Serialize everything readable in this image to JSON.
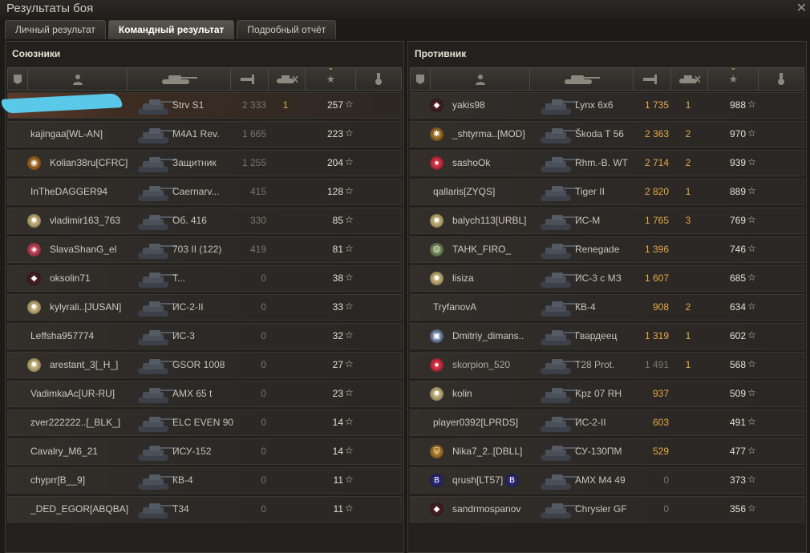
{
  "window": {
    "title": "Результаты боя",
    "close_glyph": "✕"
  },
  "tabs": [
    {
      "label": "Личный результат"
    },
    {
      "label": "Командный результат",
      "active": true
    },
    {
      "label": "Подробный отчёт"
    }
  ],
  "allies": {
    "title": "Союзники",
    "rows": [
      {
        "name": "",
        "vehicle": "Strv S1",
        "damage": "2 333",
        "kills": "1",
        "xp": "257",
        "self": true
      },
      {
        "name": "kajingaa[WL-AN]",
        "vehicle": "M4A1 Rev.",
        "damage": "1 665",
        "kills": "",
        "xp": "223"
      },
      {
        "name": "Kolian38ru[CFRC]",
        "badge": "clan",
        "vehicle": "Защитник",
        "damage": "1 255",
        "kills": "",
        "xp": "204"
      },
      {
        "name": "InTheDAGGER94",
        "vehicle": "Caernarv...",
        "damage": "415",
        "kills": "",
        "xp": "128"
      },
      {
        "name": "vladimir163_763",
        "badge": "star",
        "vehicle": "Об. 416",
        "damage": "330",
        "kills": "",
        "xp": "85"
      },
      {
        "name": "SlavaShanG_el",
        "badge": "shield",
        "vehicle": "703 II (122)",
        "damage": "419",
        "kills": "",
        "xp": "81"
      },
      {
        "name": "oksolin71",
        "badge": "diamond",
        "vehicle": "T...",
        "damage": "0",
        "kills": "",
        "xp": "38"
      },
      {
        "name": "kylyrali..[JUSAN]",
        "badge": "star",
        "vehicle": "ИС-2-II",
        "damage": "0",
        "kills": "",
        "xp": "33"
      },
      {
        "name": "Leffsha957774",
        "vehicle": "ИС-3",
        "damage": "0",
        "kills": "",
        "xp": "32"
      },
      {
        "name": "arestant_3[_H_]",
        "badge": "star",
        "vehicle": "GSOR 1008",
        "damage": "0",
        "kills": "",
        "xp": "27"
      },
      {
        "name": "VadimkaAc[UR-RU]",
        "vehicle": "AMX 65 t",
        "damage": "0",
        "kills": "",
        "xp": "23"
      },
      {
        "name": "zver222222..[_BLK_]",
        "vehicle": "ELC EVEN 90",
        "damage": "0",
        "kills": "",
        "xp": "14"
      },
      {
        "name": "Cavalry_M6_21",
        "vehicle": "ИСУ-152",
        "damage": "0",
        "kills": "",
        "xp": "14"
      },
      {
        "name": "chyprr[B__9]",
        "vehicle": "КВ-4",
        "damage": "0",
        "kills": "",
        "xp": "11"
      },
      {
        "name": "_DED_EGOR[ABQBA]",
        "vehicle": "T34",
        "damage": "0",
        "kills": "",
        "xp": "11"
      }
    ]
  },
  "enemies": {
    "title": "Противник",
    "rows": [
      {
        "name": "yakis98",
        "badge": "diamond",
        "vehicle": "Lynx 6x6",
        "damage": "1 735",
        "kills": "1",
        "xp": "988"
      },
      {
        "name": "_shtyrma..[MOD]",
        "badge": "square",
        "vehicle": "Škoda T 56",
        "damage": "2 363",
        "kills": "2",
        "xp": "970"
      },
      {
        "name": "sashoOk",
        "badge": "red",
        "vehicle": "Rhm.-B. WT",
        "damage": "2 714",
        "kills": "2",
        "xp": "939"
      },
      {
        "name": "qallaris[ZYQS]",
        "vehicle": "Tiger II",
        "damage": "2 820",
        "kills": "1",
        "xp": "889"
      },
      {
        "name": "balych113[URBL]",
        "badge": "star",
        "vehicle": "ИС-М",
        "damage": "1 765",
        "kills": "3",
        "xp": "769"
      },
      {
        "name": "TAHK_FIRO_",
        "badge": "hex",
        "vehicle": "Renegade",
        "damage": "1 396",
        "kills": "",
        "xp": "746"
      },
      {
        "name": "lisiza",
        "badge": "star",
        "vehicle": "ИС-3 с МЗ",
        "damage": "1 607",
        "kills": "",
        "xp": "685"
      },
      {
        "name": "TryfanovA",
        "vehicle": "КВ-4",
        "damage": "908",
        "kills": "2",
        "xp": "634"
      },
      {
        "name": "Dmitriy_dimans..",
        "badge": "cube",
        "vehicle": "Гвардеец",
        "damage": "1 319",
        "kills": "1",
        "xp": "602"
      },
      {
        "name": "skorpion_520",
        "badge": "red",
        "vehicle": "T28 Prot.",
        "damage": "1 491",
        "kills": "1",
        "xp": "568",
        "dim": true
      },
      {
        "name": "kolin",
        "badge": "star",
        "vehicle": "Kpz 07 RH",
        "damage": "937",
        "kills": "",
        "xp": "509"
      },
      {
        "name": "player0392[LPRDS]",
        "vehicle": "ИС-2-II",
        "damage": "603",
        "kills": "",
        "xp": "491"
      },
      {
        "name": "Nika7_2..[DBLL]",
        "badge": "shield2",
        "vehicle": "СУ-130ПМ",
        "damage": "529",
        "kills": "",
        "xp": "477"
      },
      {
        "name": "qrush[LT57]",
        "badge": "b",
        "badge2": "b",
        "vehicle": "AMX M4 49",
        "damage": "0",
        "kills": "",
        "xp": "373"
      },
      {
        "name": "sandrmospanov",
        "badge": "diamond",
        "vehicle": "Chrysler GF",
        "damage": "0",
        "kills": "",
        "xp": "356"
      }
    ]
  },
  "header_icons": [
    "platoon-icon",
    "player-icon",
    "tank-icon",
    "damage-icon",
    "kills-icon",
    "xp-star-icon",
    "medal-icon"
  ],
  "star_glyph": "☆",
  "colors": {
    "accent": "#e6a945",
    "xp": "#e6e0d2",
    "self_row": "#5a3a2a"
  }
}
